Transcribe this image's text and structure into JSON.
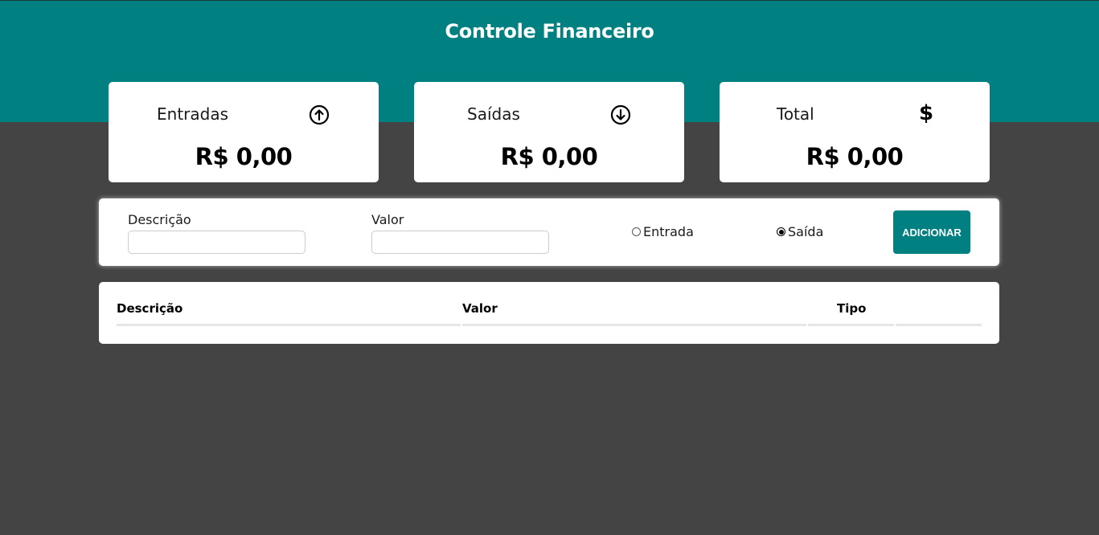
{
  "header": {
    "title": "Controle Financeiro",
    "color": "#008080"
  },
  "cards": {
    "entradas": {
      "label": "Entradas",
      "value": "R$ 0,00",
      "icon": "arrow-up-circle-icon"
    },
    "saidas": {
      "label": "Saídas",
      "value": "R$ 0,00",
      "icon": "arrow-down-circle-icon"
    },
    "total": {
      "label": "Total",
      "value": "R$ 0,00",
      "icon": "dollar-icon",
      "icon_glyph": "$"
    }
  },
  "form": {
    "descricao_label": "Descrição",
    "descricao_value": "",
    "valor_label": "Valor",
    "valor_value": "",
    "radio_entrada_label": "Entrada",
    "radio_saida_label": "Saída",
    "selected_type": "Saída",
    "add_button_label": "ADICIONAR"
  },
  "table": {
    "columns": [
      "Descrição",
      "Valor",
      "Tipo"
    ],
    "rows": []
  },
  "colors": {
    "background": "#444444",
    "accent": "#008080"
  }
}
